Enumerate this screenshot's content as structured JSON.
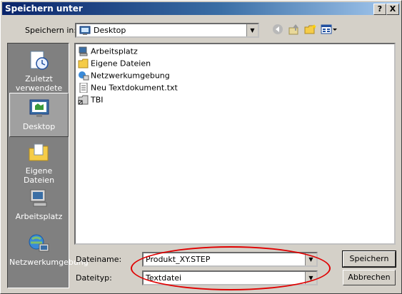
{
  "window": {
    "title": "Speichern unter",
    "help_btn": "?",
    "close_btn": "X"
  },
  "toolbar": {
    "save_in_label": "Speichern in:",
    "location": "Desktop",
    "back_icon": "back-arrow-icon",
    "up_icon": "up-folder-icon",
    "new_folder_icon": "new-folder-icon",
    "views_icon": "view-menu-icon"
  },
  "places": [
    {
      "label": "Zuletzt verwendete D...",
      "icon": "recent-documents-icon"
    },
    {
      "label": "Desktop",
      "icon": "desktop-icon",
      "active": true
    },
    {
      "label": "Eigene Dateien",
      "icon": "my-documents-icon"
    },
    {
      "label": "Arbeitsplatz",
      "icon": "my-computer-icon"
    },
    {
      "label": "Netzwerkumgebung",
      "icon": "network-places-icon"
    }
  ],
  "files": [
    {
      "name": "Arbeitsplatz",
      "icon": "my-computer-icon"
    },
    {
      "name": "Eigene Dateien",
      "icon": "folder-icon"
    },
    {
      "name": "Netzwerkumgebung",
      "icon": "network-icon"
    },
    {
      "name": "Neu Textdokument.txt",
      "icon": "text-file-icon"
    },
    {
      "name": "TBI",
      "icon": "shortcut-folder-icon"
    }
  ],
  "form": {
    "filename_label": "Dateiname:",
    "filename_value": "Produkt_XY.STEP",
    "filetype_label": "Dateityp:",
    "filetype_value": "Textdatei"
  },
  "buttons": {
    "save": "Speichern",
    "cancel": "Abbrechen"
  },
  "colors": {
    "title_start": "#0a246a",
    "title_end": "#a6caf0",
    "annotation": "#e00000",
    "dialog_bg": "#d4d0c8"
  }
}
